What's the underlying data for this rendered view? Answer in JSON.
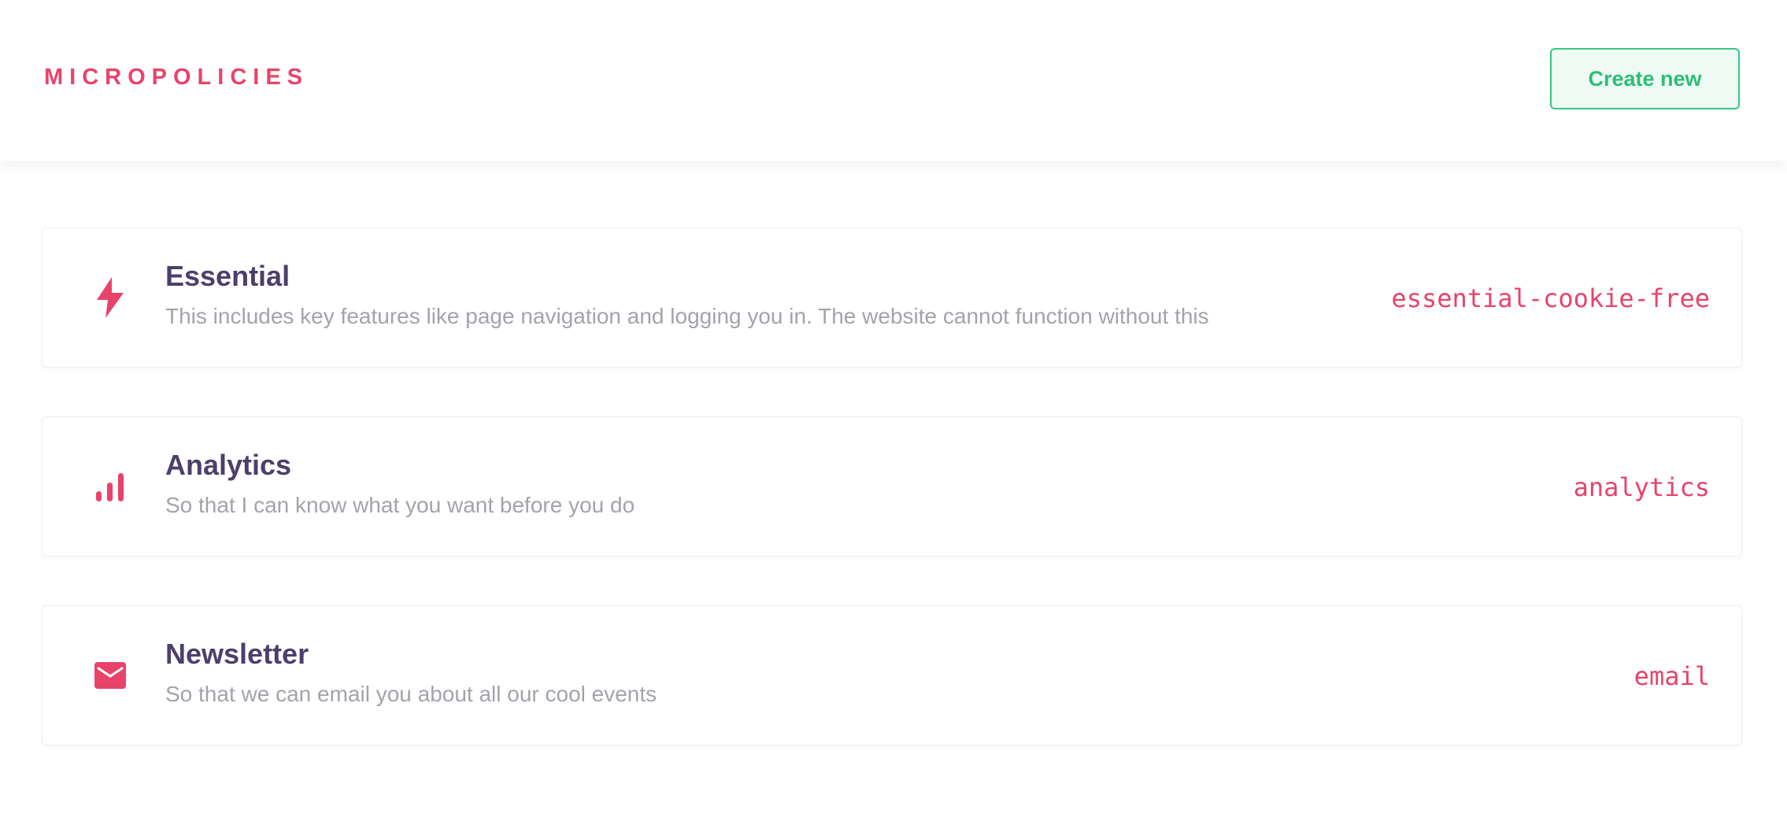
{
  "header": {
    "brand": "MICROPOLICIES",
    "create_label": "Create new"
  },
  "colors": {
    "accent": "#e8436b",
    "title": "#4c3f6b",
    "muted": "#a3a3ab",
    "button_text": "#2ebd78",
    "button_border": "#38c684",
    "button_bg": "#eefaf3"
  },
  "policies": [
    {
      "icon": "lightning-icon",
      "title": "Essential",
      "description": "This includes key features like page navigation and logging you in. The website cannot function without this",
      "slug": "essential-cookie-free"
    },
    {
      "icon": "bar-chart-icon",
      "title": "Analytics",
      "description": "So that I can know what you want before you do",
      "slug": "analytics"
    },
    {
      "icon": "envelope-icon",
      "title": "Newsletter",
      "description": "So that we can email you about all our cool events",
      "slug": "email"
    }
  ]
}
